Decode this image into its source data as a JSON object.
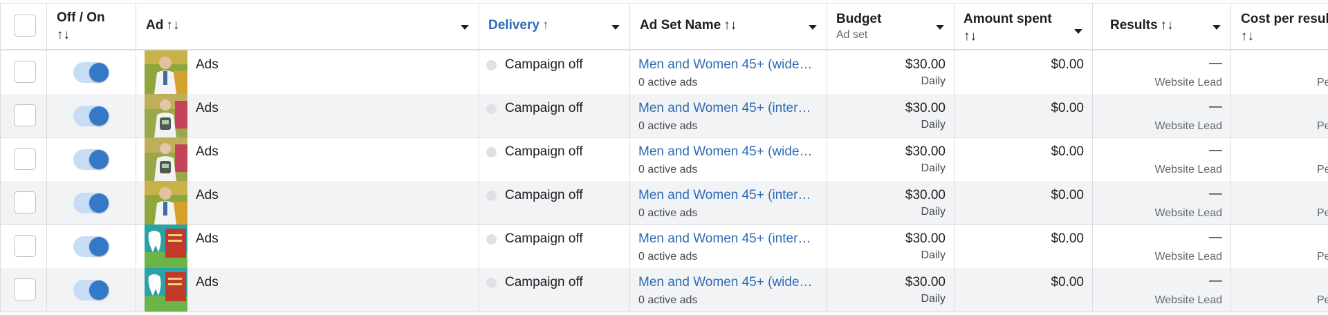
{
  "header": {
    "off_on": "Off / On",
    "ad": "Ad",
    "delivery": "Delivery",
    "delivery_sort": "↑",
    "ad_set_name": "Ad Set Name",
    "budget": "Budget",
    "budget_sub": "Ad set",
    "amount_spent": "Amount spent",
    "results": "Results",
    "cost_per_result": "Cost per resul",
    "sort_icon": "↑↓"
  },
  "colors": {
    "link": "#2d6bb5",
    "toggle_on": "#3578c6",
    "row_alt": "#f2f3f5"
  },
  "rows": [
    {
      "toggle_on": true,
      "thumb": "doctor",
      "ad": "Ads",
      "delivery": "Campaign off",
      "ad_set": "Men and Women 45+ (wide…",
      "ad_set_sub": "0 active ads",
      "budget": "$30.00",
      "budget_sub": "Daily",
      "spent": "$0.00",
      "results": "—",
      "results_sub": "Website Lead",
      "cpr_sub": "Pe"
    },
    {
      "toggle_on": true,
      "thumb": "device",
      "ad": "Ads",
      "delivery": "Campaign off",
      "ad_set": "Men and Women 45+ (inter…",
      "ad_set_sub": "0 active ads",
      "budget": "$30.00",
      "budget_sub": "Daily",
      "spent": "$0.00",
      "results": "—",
      "results_sub": "Website Lead",
      "cpr_sub": "Pe"
    },
    {
      "toggle_on": true,
      "thumb": "device",
      "ad": "Ads",
      "delivery": "Campaign off",
      "ad_set": "Men and Women 45+ (wide…",
      "ad_set_sub": "0 active ads",
      "budget": "$30.00",
      "budget_sub": "Daily",
      "spent": "$0.00",
      "results": "—",
      "results_sub": "Website Lead",
      "cpr_sub": "Pe"
    },
    {
      "toggle_on": true,
      "thumb": "doctor",
      "ad": "Ads",
      "delivery": "Campaign off",
      "ad_set": "Men and Women 45+ (inter…",
      "ad_set_sub": "0 active ads",
      "budget": "$30.00",
      "budget_sub": "Daily",
      "spent": "$0.00",
      "results": "—",
      "results_sub": "Website Lead",
      "cpr_sub": "Pe"
    },
    {
      "toggle_on": true,
      "thumb": "tooth",
      "ad": "Ads",
      "delivery": "Campaign off",
      "ad_set": "Men and Women 45+ (inter…",
      "ad_set_sub": "0 active ads",
      "budget": "$30.00",
      "budget_sub": "Daily",
      "spent": "$0.00",
      "results": "—",
      "results_sub": "Website Lead",
      "cpr_sub": "Pe"
    },
    {
      "toggle_on": true,
      "thumb": "tooth",
      "ad": "Ads",
      "delivery": "Campaign off",
      "ad_set": "Men and Women 45+ (wide…",
      "ad_set_sub": "0 active ads",
      "budget": "$30.00",
      "budget_sub": "Daily",
      "spent": "$0.00",
      "results": "—",
      "results_sub": "Website Lead",
      "cpr_sub": "Pe"
    }
  ]
}
